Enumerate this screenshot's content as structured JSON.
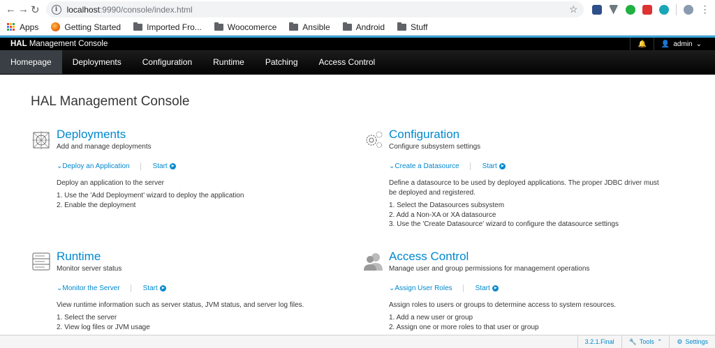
{
  "browser": {
    "url_host": "localhost",
    "url_path": ":9990/console/index.html",
    "bookmarks": [
      {
        "label": "Apps",
        "icon": "apps-grid-icon"
      },
      {
        "label": "Getting Started",
        "icon": "firefox-icon"
      },
      {
        "label": "Imported Fro...",
        "icon": "folder-icon"
      },
      {
        "label": "Woocomerce",
        "icon": "folder-icon"
      },
      {
        "label": "Ansible",
        "icon": "folder-icon"
      },
      {
        "label": "Android",
        "icon": "folder-icon"
      },
      {
        "label": "Stuff",
        "icon": "folder-icon"
      }
    ]
  },
  "header": {
    "brand_bold": "HAL",
    "brand_rest": " Management Console",
    "user": "admin",
    "accent": "#39a5dc"
  },
  "nav": {
    "items": [
      "Homepage",
      "Deployments",
      "Configuration",
      "Runtime",
      "Patching",
      "Access Control"
    ],
    "active": "Homepage"
  },
  "main": {
    "title": "HAL Management Console",
    "cards": [
      {
        "title": "Deployments",
        "subtitle": "Add and manage deployments",
        "action": "Deploy an Application",
        "start": "Start",
        "description": "Deploy an application to the server",
        "steps": [
          "1. Use the 'Add Deployment' wizard to deploy the application",
          "2. Enable the deployment"
        ]
      },
      {
        "title": "Configuration",
        "subtitle": "Configure subsystem settings",
        "action": "Create a Datasource",
        "start": "Start",
        "description": "Define a datasource to be used by deployed applications. The proper JDBC driver must be deployed and registered.",
        "steps": [
          "1. Select the Datasources subsystem",
          "2. Add a Non-XA or XA datasource",
          "3. Use the 'Create Datasource' wizard to configure the datasource settings"
        ]
      },
      {
        "title": "Runtime",
        "subtitle": "Monitor server status",
        "action": "Monitor the Server",
        "start": "Start",
        "description": "View runtime information such as server status, JVM status, and server log files.",
        "steps": [
          "1. Select the server",
          "2. View log files or JVM usage"
        ]
      },
      {
        "title": "Access Control",
        "subtitle": "Manage user and group permissions for management operations",
        "action": "Assign User Roles",
        "start": "Start",
        "description": "Assign roles to users or groups to determine access to system resources.",
        "steps": [
          "1. Add a new user or group",
          "2. Assign one or more roles to that user or group"
        ]
      }
    ]
  },
  "footer": {
    "version": "3.2.1.Final",
    "tools": "Tools",
    "settings": "Settings"
  }
}
